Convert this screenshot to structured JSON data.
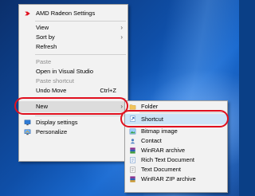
{
  "colors": {
    "desktop_blue": "#0f4fa8",
    "menu_background": "#f2f2f2",
    "highlight_gray": "#dcdcdc",
    "highlight_blue": "#cce4f7",
    "annotation_red": "#e0101e",
    "amd_red": "#e0101e"
  },
  "context_menu": {
    "amd_label": "AMD Radeon Settings",
    "view_label": "View",
    "sort_by_label": "Sort by",
    "refresh_label": "Refresh",
    "paste_label": "Paste",
    "open_vs_label": "Open in Visual Studio",
    "paste_shortcut_label": "Paste shortcut",
    "undo_move_label": "Undo Move",
    "undo_move_shortcut": "Ctrl+Z",
    "new_label": "New",
    "display_settings_label": "Display settings",
    "personalize_label": "Personalize",
    "submenu_arrow": "›"
  },
  "new_submenu": {
    "folder_label": "Folder",
    "shortcut_label": "Shortcut",
    "bitmap_label": "Bitmap image",
    "contact_label": "Contact",
    "winrar_label": "WinRAR archive",
    "rtf_label": "Rich Text Document",
    "text_label": "Text Document",
    "winrar_zip_label": "WinRAR ZIP archive"
  },
  "icons": {
    "amd": "amd-radeon-icon",
    "display": "display-settings-icon",
    "personalize": "personalize-icon",
    "folder": "folder-icon",
    "shortcut": "shortcut-icon",
    "bitmap": "bitmap-image-icon",
    "contact": "contact-icon",
    "winrar": "winrar-archive-icon",
    "rtf": "rich-text-icon",
    "text": "text-document-icon",
    "winrar_zip": "winrar-zip-icon"
  }
}
